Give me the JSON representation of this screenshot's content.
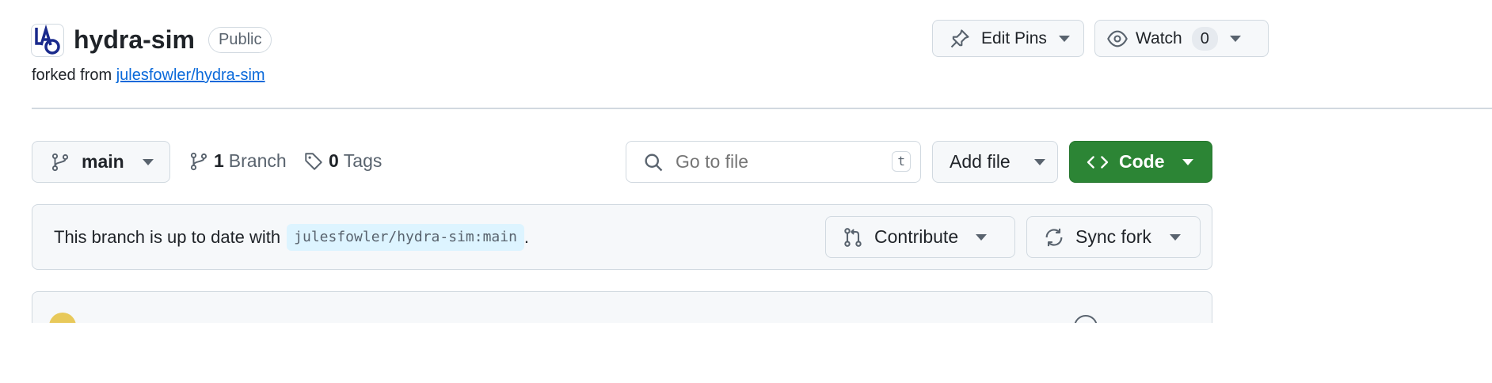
{
  "repo": {
    "name": "hydra-sim",
    "visibility": "Public",
    "forked_prefix": "forked from",
    "forked_from": "julesfowler/hydra-sim",
    "avatar_text": "LAO"
  },
  "header_actions": {
    "edit_pins_label": "Edit Pins",
    "watch_label": "Watch",
    "watch_count": "0"
  },
  "toolbar": {
    "branch_name": "main",
    "branch_count": "1",
    "branch_label": "Branch",
    "tag_count": "0",
    "tag_label": "Tags",
    "search_placeholder": "Go to file",
    "search_shortcut": "t",
    "add_file_label": "Add file",
    "code_label": "Code"
  },
  "fork_status": {
    "prefix": "This branch is up to date with",
    "ref": "julesfowler/hydra-sim:main",
    "suffix": ".",
    "contribute_label": "Contribute",
    "sync_fork_label": "Sync fork"
  },
  "colors": {
    "accent": "#0969da",
    "code_button": "#2c8535",
    "border": "#d1d9e0",
    "muted_bg": "#f6f8fa"
  }
}
